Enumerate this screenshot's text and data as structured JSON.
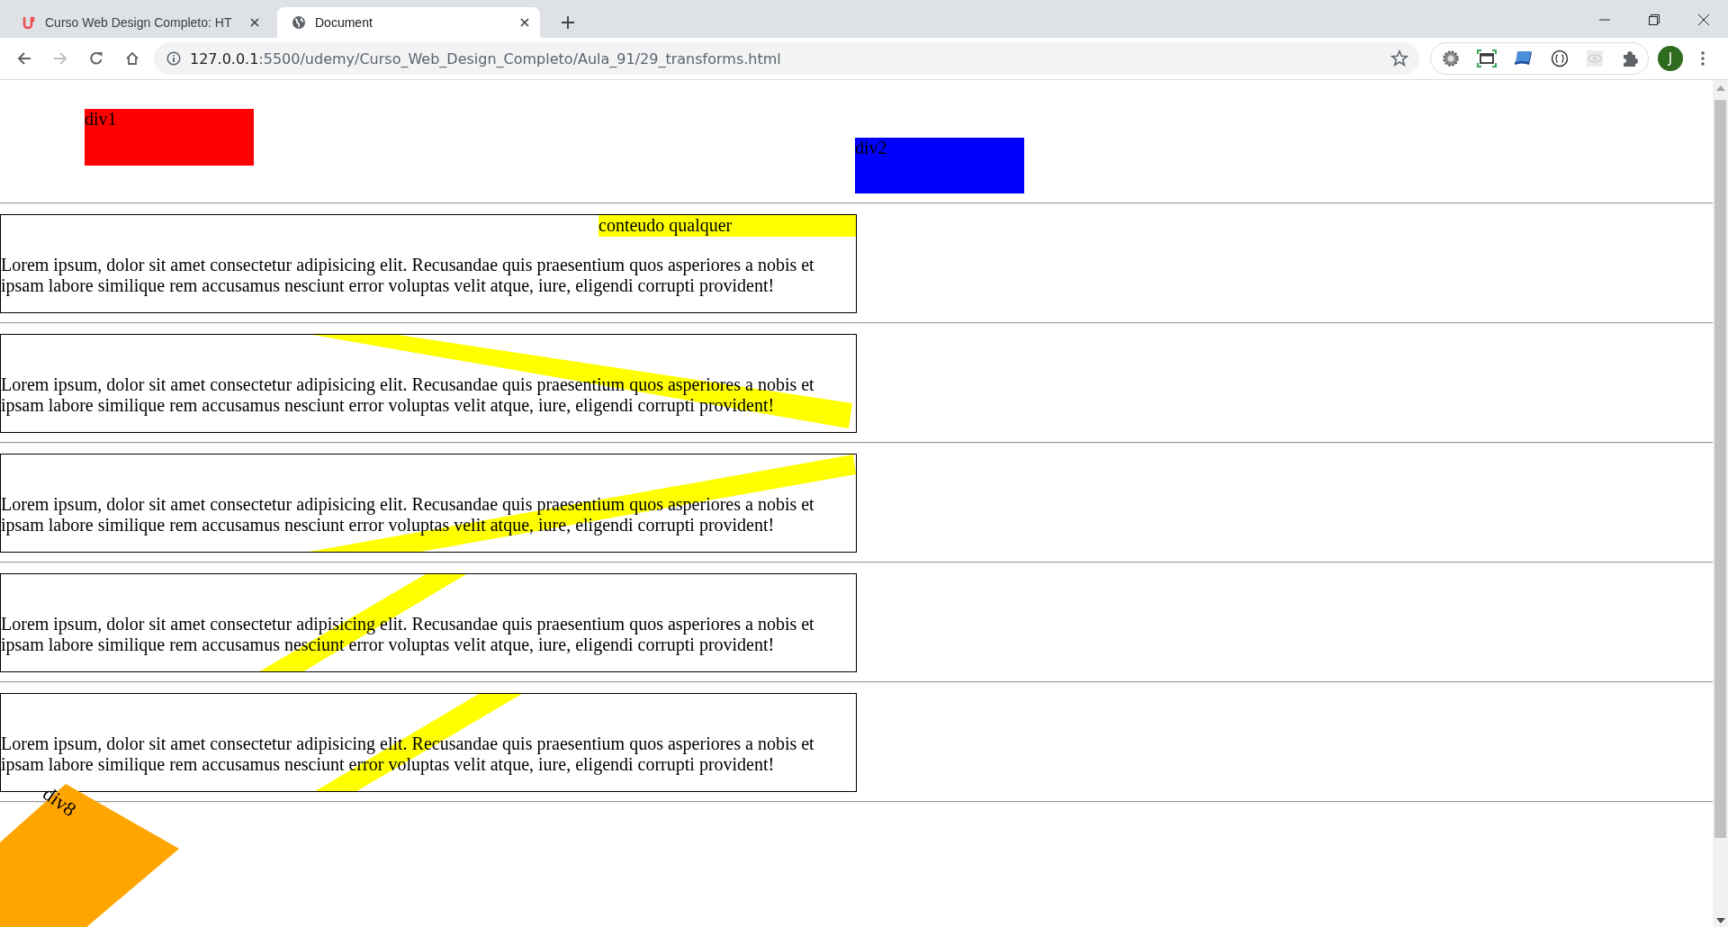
{
  "browser": {
    "tabs": [
      {
        "title": "Curso Web Design Completo: HT",
        "selected": false
      },
      {
        "title": "Document",
        "selected": true
      }
    ],
    "address": {
      "host": "127.0.0.1",
      "path": ":5500/udemy/Curso_Web_Design_Completo/Aula_91/29_transforms.html"
    },
    "profile": {
      "initial": "J"
    }
  },
  "page": {
    "blocks": [
      {
        "label": "div1",
        "color": "#ff0000"
      },
      {
        "label": "div2",
        "color": "#0000ff"
      }
    ],
    "boxes": [
      {
        "kind": "label",
        "label": "conteudo qualquer",
        "text": "Lorem ipsum, dolor sit amet consectetur adipisicing elit. Recusandae quis praesentium quos asperiores a nobis et ipsam labore similique rem accusamus nesciunt error voluptas velit atque, iure, eligendi corrupti provident!"
      },
      {
        "kind": "band-down",
        "text": "Lorem ipsum, dolor sit amet consectetur adipisicing elit. Recusandae quis praesentium quos asperiores a nobis et ipsam labore similique rem accusamus nesciunt error voluptas velit atque, iure, eligendi corrupti provident!"
      },
      {
        "kind": "band-up",
        "text": "Lorem ipsum, dolor sit amet consectetur adipisicing elit. Recusandae quis praesentium quos asperiores a nobis et ipsam labore similique rem accusamus nesciunt error voluptas velit atque, iure, eligendi corrupti provident!"
      },
      {
        "kind": "band-steep",
        "text": "Lorem ipsum, dolor sit amet consectetur adipisicing elit. Recusandae quis praesentium quos asperiores a nobis et ipsam labore similique rem accusamus nesciunt error voluptas velit atque, iure, eligendi corrupti provident!"
      },
      {
        "kind": "band-steep-right",
        "text": "Lorem ipsum, dolor sit amet consectetur adipisicing elit. Recusandae quis praesentium quos asperiores a nobis et ipsam labore similique rem accusamus nesciunt error voluptas velit atque, iure, eligendi corrupti provident!"
      }
    ],
    "shape": {
      "label": "div8"
    }
  }
}
